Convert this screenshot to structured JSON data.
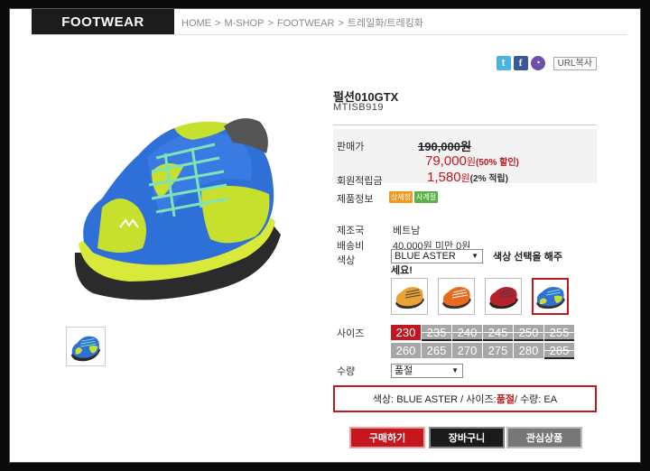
{
  "header": {
    "category": "FOOTWEAR",
    "breadcrumb": [
      "HOME",
      "M-SHOP",
      "FOOTWEAR",
      "트레일화/트레킹화"
    ],
    "breadcrumb_sep": ">"
  },
  "share": {
    "icons": [
      "twitter-icon",
      "facebook-icon",
      "me2day-icon"
    ],
    "url_copy": "URL복사"
  },
  "product": {
    "name": "펄션010GTX",
    "code": "MTISB919",
    "labels": {
      "price": "판매가",
      "points": "회원적립금",
      "info": "제품정보",
      "origin": "제조국",
      "shipping": "배송비",
      "color": "색상",
      "size": "사이즈",
      "qty": "수량"
    },
    "original_price": "190,000원",
    "sale_price": "79,000",
    "sale_unit": "원",
    "discount": "(50% 할인)",
    "points": "1,580",
    "points_unit": "원",
    "points_rate": "(2% 적립)",
    "badges": [
      "상세정",
      "사계절"
    ],
    "origin": "베트남",
    "shipping": "40,000원 미만 0원",
    "color_selected": "BLUE ASTER",
    "color_hint": "색상 선택을 해주세요!",
    "qty_selected": "품절",
    "sizes": [
      {
        "label": "230",
        "state": "selected"
      },
      {
        "label": "235",
        "state": "soldout"
      },
      {
        "label": "240",
        "state": "soldout"
      },
      {
        "label": "245",
        "state": "soldout"
      },
      {
        "label": "250",
        "state": "soldout"
      },
      {
        "label": "255",
        "state": "soldout"
      },
      {
        "label": "260",
        "state": "available"
      },
      {
        "label": "265",
        "state": "available"
      },
      {
        "label": "270",
        "state": "available"
      },
      {
        "label": "275",
        "state": "available"
      },
      {
        "label": "280",
        "state": "available"
      },
      {
        "label": "285",
        "state": "soldout"
      }
    ]
  },
  "summary": {
    "prefix": "색상: BLUE ASTER / 사이즈: ",
    "size": "품절",
    "suffix": " / 수량: EA"
  },
  "buttons": {
    "buy": "구매하기",
    "cart": "장바구니",
    "wish": "관심상품"
  },
  "colors": {
    "accent": "#c0181e",
    "header_bg": "#1c1c1c"
  }
}
